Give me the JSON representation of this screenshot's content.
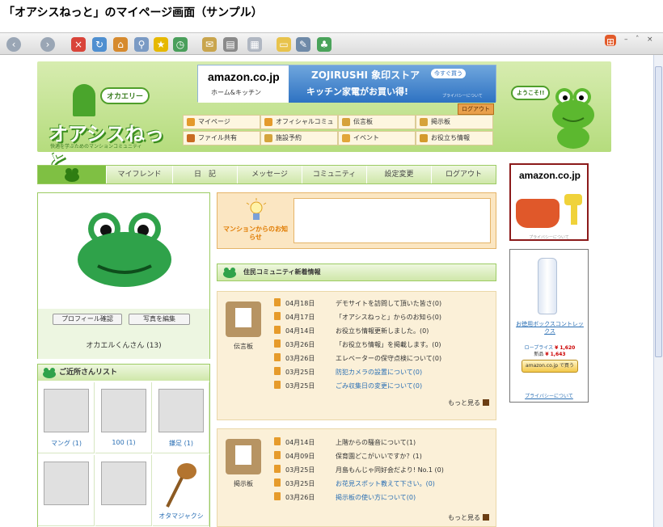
{
  "caption": "「オアシスねっと」のマイページ画面（サンプル）",
  "window": {
    "minimize": "–",
    "restore": "ˆ",
    "close": "×"
  },
  "header": {
    "logo_text": "オアシスねっと",
    "logo_bubble": "オカエリー",
    "logo_sub": "快適を学ぶためのマンションコミュニティ",
    "frog_bubble": "ようこそ!!",
    "logout": "ログアウト",
    "nav": [
      {
        "label": "マイページ",
        "color": "#e49a2c"
      },
      {
        "label": "オフィシャルコミュニティ",
        "color": "#e49a2c"
      },
      {
        "label": "伝言板",
        "color": "#d6a23a"
      },
      {
        "label": "掲示板",
        "color": "#d6a23a"
      },
      {
        "label": "ファイル共有",
        "color": "#c96b22"
      },
      {
        "label": "施設予約",
        "color": "#d4a43c"
      },
      {
        "label": "イベント",
        "color": "#e2a63a"
      },
      {
        "label": "お役立ち情報",
        "color": "#d49a2c"
      }
    ]
  },
  "banner": {
    "amazon": "amazon.co.jp",
    "category": "ホーム&キッチン",
    "brand": "ZOJIRUSHI 象印ストア",
    "cta": "今すぐ買う",
    "promo": "キッチン家電がお買い得!",
    "privacy": "プライバシーについて"
  },
  "menu": [
    "マイフレンド",
    "日　記",
    "メッセージ",
    "コミュニティ",
    "設定変更",
    "ログアウト"
  ],
  "profile": {
    "confirm_button": "プロフィール確認",
    "edit_photo_button": "写真を編集",
    "name": "オカエルくんさん (13)"
  },
  "neighbors": {
    "title": "ご近所さんリスト",
    "items": [
      {
        "label": "マング (1)",
        "image": "No Image"
      },
      {
        "label": "100 (1)",
        "image": "No Image"
      },
      {
        "label": "鎌足 (1)",
        "image": "No Image"
      },
      {
        "label": "",
        "image": "No Image"
      },
      {
        "label": "",
        "image": "No Image"
      },
      {
        "label": "オタマジャクシ",
        "image": ""
      }
    ]
  },
  "notice": {
    "label": "マンションからのお知らせ"
  },
  "community": {
    "title": "住民コミュニティ新着情報"
  },
  "boards": [
    {
      "name": "伝言板",
      "rows": [
        {
          "date": "04月18日",
          "title": "デモサイトを訪問して頂いた皆さ(0)",
          "link": false
        },
        {
          "date": "04月17日",
          "title": "「オアシスねっと」からのお知ら(0)",
          "link": false
        },
        {
          "date": "04月14日",
          "title": "お役立ち情報更新しました。(0)",
          "link": false
        },
        {
          "date": "03月26日",
          "title": "「お役立ち情報」を掲載します。(0)",
          "link": false
        },
        {
          "date": "03月26日",
          "title": "エレベーターの保守点検について(0)",
          "link": false
        },
        {
          "date": "03月25日",
          "title": "防犯カメラの設置について(0)",
          "link": true
        },
        {
          "date": "03月25日",
          "title": "ごみ収集日の変更について(0)",
          "link": true
        }
      ],
      "more": "もっと見る"
    },
    {
      "name": "掲示板",
      "rows": [
        {
          "date": "04月14日",
          "title": "上階からの騒音について(1)",
          "link": false
        },
        {
          "date": "04月09日",
          "title": "保育園どこがいいですか？(1)",
          "link": false
        },
        {
          "date": "03月25日",
          "title": "月島もんじゃ同好会だより! No.1 (0)",
          "link": false
        },
        {
          "date": "03月25日",
          "title": "お花見スポット教えて下さい。(0)",
          "link": true
        },
        {
          "date": "03月26日",
          "title": "掲示板の使い方について(0)",
          "link": true
        }
      ],
      "more": "もっと見る"
    }
  ],
  "ads": {
    "amazon_logo": "amazon.co.jp",
    "privacy": "プライバシーについて",
    "water_title": "お徳用ボックスコントレックス",
    "water_price_label": "ロープライス",
    "water_price": "¥ 1,620",
    "water_new_label": "新品",
    "water_new_price": "¥ 1,643",
    "buy": "amazon.co.jp で買う"
  }
}
